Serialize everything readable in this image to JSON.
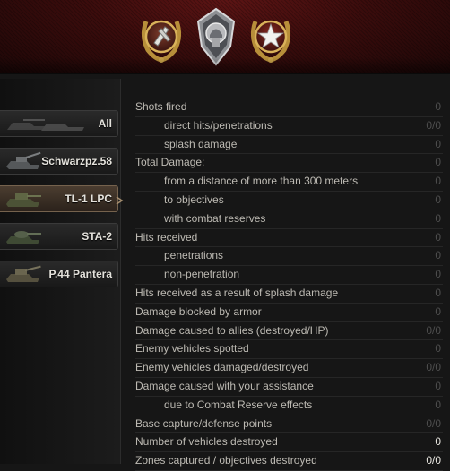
{
  "header": {
    "medals": [
      {
        "icon": "artillery-shell-medal-icon",
        "color": "#c9a24a"
      },
      {
        "icon": "helmet-badge-icon",
        "color": "#c6c7c9"
      },
      {
        "icon": "star-laurel-medal-icon",
        "color": "#c9a24a"
      }
    ]
  },
  "sidebar": {
    "tabs": [
      {
        "label": "All",
        "active": false
      },
      {
        "label": "Schwarzpz.58",
        "active": false
      },
      {
        "label": "TL-1 LPC",
        "active": true
      },
      {
        "label": "STA-2",
        "active": false
      },
      {
        "label": "P.44 Pantera",
        "active": false
      }
    ]
  },
  "stats": [
    {
      "label": "Shots fired",
      "value": "0",
      "indent": false,
      "bright": false
    },
    {
      "label": "direct hits/penetrations",
      "value": "0/0",
      "indent": true,
      "bright": false
    },
    {
      "label": "splash damage",
      "value": "0",
      "indent": true,
      "bright": false
    },
    {
      "label": "Total Damage:",
      "value": "0",
      "indent": false,
      "bright": false
    },
    {
      "label": "from a distance of more than 300 meters",
      "value": "0",
      "indent": true,
      "bright": false
    },
    {
      "label": "to objectives",
      "value": "0",
      "indent": true,
      "bright": false
    },
    {
      "label": "with combat reserves",
      "value": "0",
      "indent": true,
      "bright": false
    },
    {
      "label": "Hits received",
      "value": "0",
      "indent": false,
      "bright": false
    },
    {
      "label": "penetrations",
      "value": "0",
      "indent": true,
      "bright": false
    },
    {
      "label": "non-penetration",
      "value": "0",
      "indent": true,
      "bright": false
    },
    {
      "label": "Hits received as a result of splash damage",
      "value": "0",
      "indent": false,
      "bright": false
    },
    {
      "label": "Damage blocked by armor",
      "value": "0",
      "indent": false,
      "bright": false
    },
    {
      "label": "Damage caused to allies (destroyed/HP)",
      "value": "0/0",
      "indent": false,
      "bright": false
    },
    {
      "label": "Enemy vehicles spotted",
      "value": "0",
      "indent": false,
      "bright": false
    },
    {
      "label": "Enemy vehicles damaged/destroyed",
      "value": "0/0",
      "indent": false,
      "bright": false
    },
    {
      "label": "Damage caused with your assistance",
      "value": "0",
      "indent": false,
      "bright": false
    },
    {
      "label": "due to Combat Reserve effects",
      "value": "0",
      "indent": true,
      "bright": false
    },
    {
      "label": "Base capture/defense points",
      "value": "0/0",
      "indent": false,
      "bright": false
    },
    {
      "label": "Number of vehicles destroyed",
      "value": "0",
      "indent": false,
      "bright": true
    },
    {
      "label": "Zones captured / objectives destroyed",
      "value": "0/0",
      "indent": false,
      "bright": true
    }
  ]
}
